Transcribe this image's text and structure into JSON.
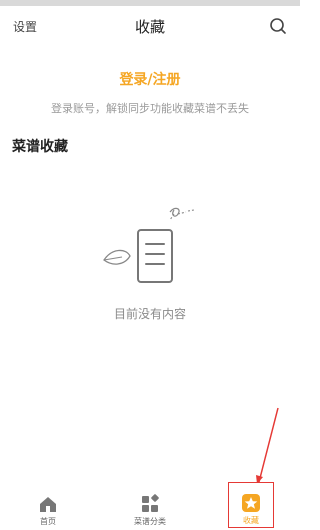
{
  "header": {
    "left_link": "设置",
    "title": "收藏",
    "search_icon": "search-icon"
  },
  "login": {
    "link": "登录/注册",
    "hint": "登录账号，解锁同步功能收藏菜谱不丢失"
  },
  "section": {
    "title": "菜谱收藏"
  },
  "empty_state": {
    "text": "目前没有内容"
  },
  "tabbar": {
    "items": [
      {
        "label": "首页",
        "icon": "home-icon",
        "active": false
      },
      {
        "label": "菜谱分类",
        "icon": "grid-icon",
        "active": false
      },
      {
        "label": "收藏",
        "icon": "star-icon",
        "active": true
      }
    ]
  },
  "colors": {
    "accent": "#f5a623",
    "annotation": "#e53935",
    "hint": "#9a9a9a"
  }
}
